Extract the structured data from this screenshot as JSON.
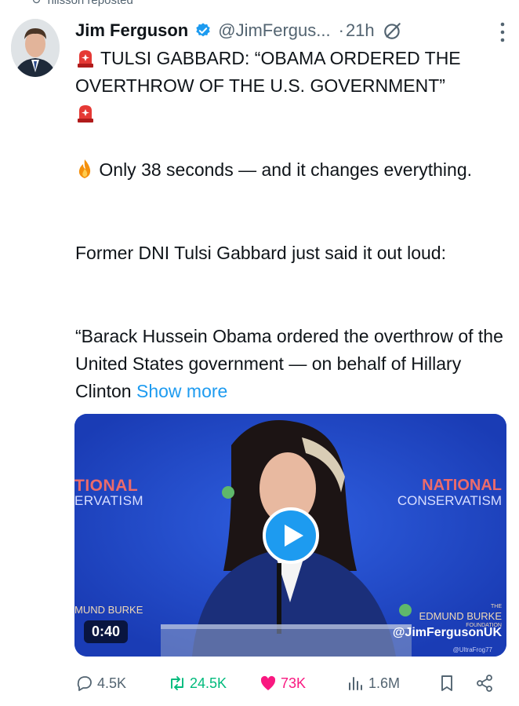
{
  "repost_label": "nilsson reposted",
  "author": {
    "name": "Jim Ferguson",
    "handle": "@JimFergus...",
    "time": "21h",
    "dot": "·"
  },
  "post": {
    "line1": "TULSI GABBARD: “OBAMA ORDERED THE OVERTHROW OF THE U.S. GOVERNMENT”",
    "line2": "Only 38 seconds — and it changes everything.",
    "line3": "Former DNI Tulsi Gabbard just said it out loud:",
    "line4": "“Barack Hussein Obama ordered the overthrow of the United States government — on behalf of Hillary Clinton",
    "show_more": "Show more"
  },
  "video": {
    "left_logo_1": "TIONAL",
    "left_logo_2": "ERVATISM",
    "right_logo_1": "NATIONAL",
    "right_logo_2": "CONSERVATISM",
    "bl_logo": "MUND BURKE",
    "br_logo_1": "THE",
    "br_logo_2": "EDMUND BURKE",
    "br_logo_3": "FOUNDATION",
    "watermark": "@JimFergusonUK",
    "watermark2": "@UltraFrog77",
    "duration": "0:40"
  },
  "actions": {
    "replies": "4.5K",
    "reposts": "24.5K",
    "likes": "73K",
    "views": "1.6M"
  },
  "colors": {
    "accent": "#1d9bf0",
    "repost": "#00ba7c",
    "like": "#f91880",
    "muted": "#536471",
    "video_bg": "#1f46c6"
  },
  "icons": [
    "repost-icon",
    "verified-icon",
    "grok-icon",
    "more-icon",
    "siren-icon",
    "fire-icon",
    "play-icon",
    "reply-icon",
    "like-icon",
    "views-icon",
    "bookmark-icon",
    "share-icon"
  ]
}
